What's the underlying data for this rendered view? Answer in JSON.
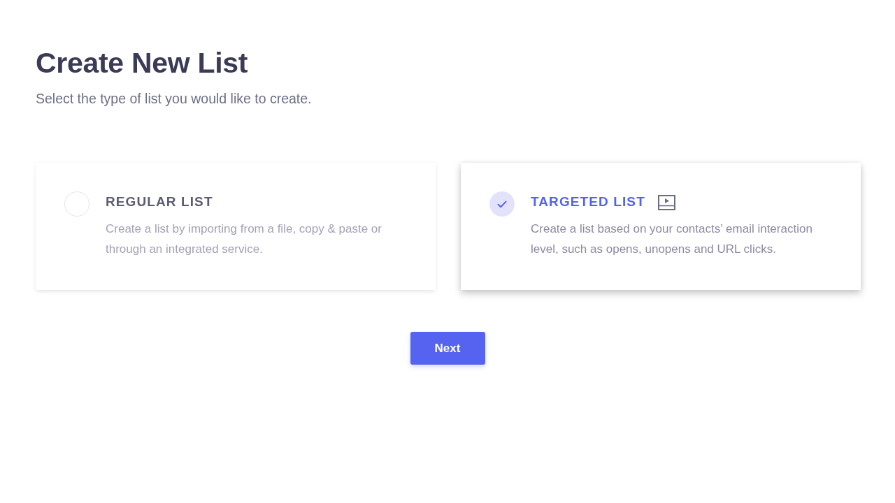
{
  "page": {
    "title": "Create New List",
    "subtitle": "Select the type of list you would like to create."
  },
  "list_types": [
    {
      "title": "REGULAR LIST",
      "description": "Create a list by importing from a file, copy & paste or through an integrated service.",
      "selected": false,
      "video_icon": false
    },
    {
      "title": "TARGETED LIST",
      "description": "Create a list based on your contacts’ email interaction level, such as opens, unopens and URL clicks.",
      "selected": true,
      "video_icon": true
    }
  ],
  "next_button": {
    "label": "Next"
  }
}
